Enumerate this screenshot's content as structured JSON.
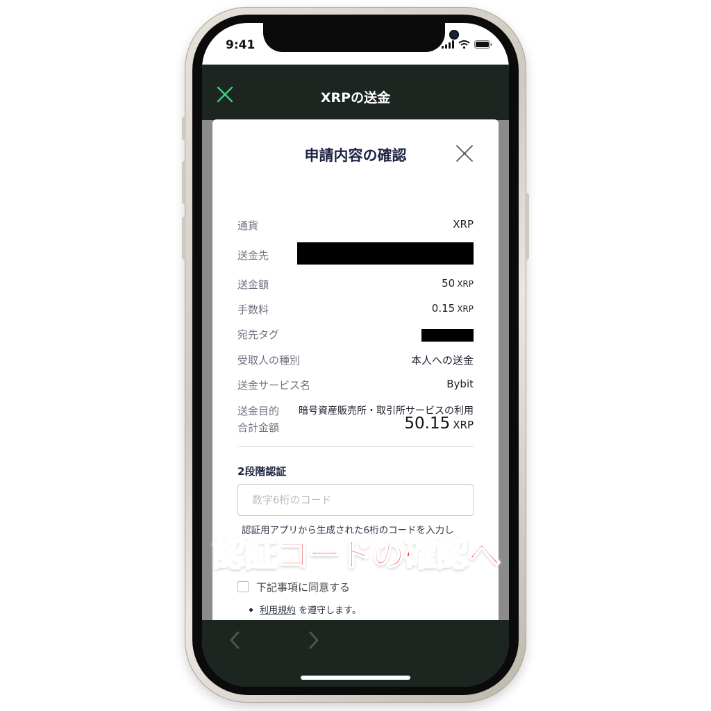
{
  "status_bar": {
    "time": "9:41"
  },
  "header": {
    "title": "XRPの送金"
  },
  "modal": {
    "title": "申請内容の確認",
    "rows": [
      {
        "label": "通貨",
        "value": "XRP",
        "unit": ""
      },
      {
        "label": "送金先",
        "value": "",
        "unit": ""
      },
      {
        "label": "送金額",
        "value": "50",
        "unit": "XRP"
      },
      {
        "label": "手数料",
        "value": "0.15",
        "unit": "XRP"
      },
      {
        "label": "宛先タグ",
        "value": "",
        "unit": ""
      },
      {
        "label": "受取人の種別",
        "value": "本人への送金",
        "unit": ""
      },
      {
        "label": "送金サービス名",
        "value": "Bybit",
        "unit": ""
      },
      {
        "label": "送金目的",
        "value": "暗号資産販売所・取引所サービスの利用",
        "unit": ""
      }
    ],
    "total": {
      "label": "合計金額",
      "value": "50.15",
      "unit": "XRP"
    },
    "two_factor": {
      "title": "2段階認証",
      "placeholder": "数字6桁のコード",
      "help": "認証用アプリから生成された6桁のコードを入力し"
    },
    "agree": {
      "label": "下記事項に同意する"
    },
    "terms": {
      "link": "利用規約",
      "suffix": "を遵守します。"
    }
  },
  "overlay": {
    "caption": "認証コードの確認へ"
  },
  "colors": {
    "header_bg": "#1d2520",
    "accent": "#33d27f",
    "caption": "#ff2a2a"
  }
}
